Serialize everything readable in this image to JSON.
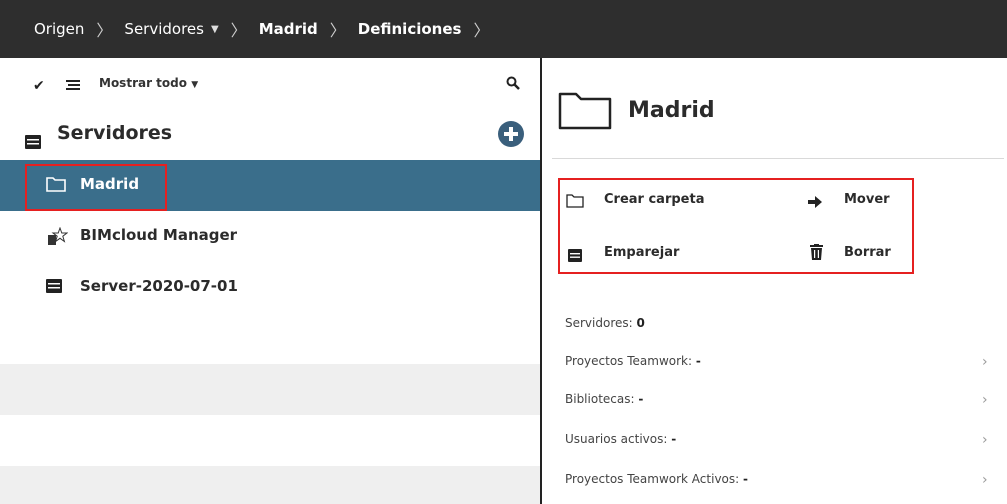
{
  "breadcrumb": {
    "items": [
      "Origen",
      "Servidores",
      "Madrid",
      "Definiciones"
    ],
    "separator": ">"
  },
  "left_toolbar": {
    "check_icon": "check-icon",
    "filter_label": "Mostrar todo",
    "search_icon": "search-icon"
  },
  "tree": {
    "root_label": "Servidores",
    "items": [
      {
        "label": "Madrid",
        "icon": "folder-icon",
        "selected": true
      },
      {
        "label": "BIMcloud Manager",
        "icon": "manager-icon",
        "selected": false
      },
      {
        "label": "Server-2020-07-01",
        "icon": "server-icon",
        "selected": false
      }
    ]
  },
  "detail": {
    "title": "Madrid",
    "actions": {
      "create_folder": "Crear carpeta",
      "move": "Mover",
      "pair": "Emparejar",
      "delete": "Borrar"
    },
    "stats": [
      {
        "label": "Servidores:",
        "value": "0"
      },
      {
        "label": "Proyectos Teamwork:",
        "value": "-"
      },
      {
        "label": "Bibliotecas:",
        "value": "-"
      },
      {
        "label": "Usuarios activos:",
        "value": "-"
      },
      {
        "label": "Proyectos Teamwork Activos:",
        "value": "-"
      }
    ]
  },
  "colors": {
    "topbar": "#2e2e2e",
    "selected_row": "#3a6e8b",
    "highlight": "#e52020",
    "add_button": "#3a5f7c"
  }
}
